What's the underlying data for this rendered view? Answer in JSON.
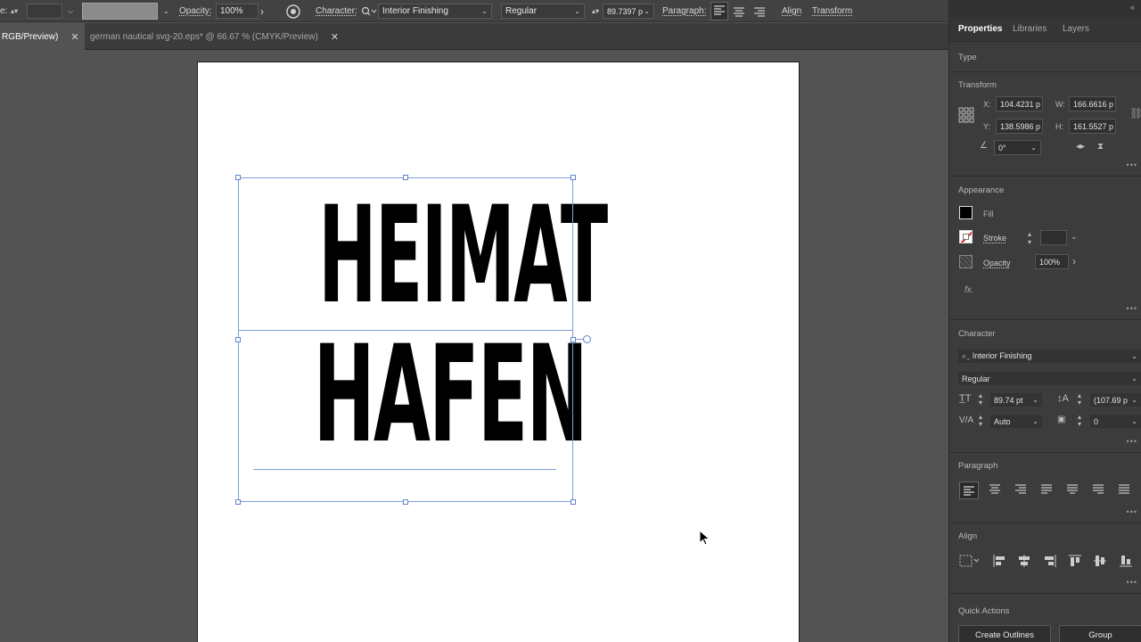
{
  "control_bar": {
    "opacity_label": "Opacity:",
    "opacity_value": "100%",
    "character_label": "Character:",
    "font_family": "Interior Finishing",
    "font_style": "Regular",
    "font_size": "89.7397 p",
    "paragraph_label": "Paragraph:",
    "align_label": "Align",
    "transform_label": "Transform"
  },
  "document_tabs": [
    {
      "label": "RGB/Preview)",
      "active": true
    },
    {
      "label": "german nautical svg-20.eps* @ 66.67 % (CMYK/Preview)",
      "active": false
    }
  ],
  "artwork": {
    "line1": "HEIMAT",
    "line2": "HAFEN"
  },
  "panel": {
    "tabs": [
      "Properties",
      "Libraries",
      "Layers"
    ],
    "type_label": "Type",
    "transform": {
      "title": "Transform",
      "x_label": "X:",
      "x_value": "104.4231 p",
      "y_label": "Y:",
      "y_value": "138.5986 p",
      "w_label": "W:",
      "w_value": "166.6616 p",
      "h_label": "H:",
      "h_value": "161.5527 p",
      "angle_value": "0°"
    },
    "appearance": {
      "title": "Appearance",
      "fill_label": "Fill",
      "stroke_label": "Stroke",
      "opacity_label": "Opacity",
      "opacity_value": "100%",
      "fx_label": "fx."
    },
    "character": {
      "title": "Character",
      "font_family": "Interior Finishing",
      "font_style": "Regular",
      "font_size": "89.74 pt",
      "leading": "(107.69 p",
      "kerning": "Auto",
      "tracking": "0"
    },
    "paragraph_title": "Paragraph",
    "align_title": "Align",
    "quick_actions": {
      "title": "Quick Actions",
      "create_outlines": "Create Outlines",
      "group": "Group"
    }
  },
  "colors": {
    "ui_dark": "#424242",
    "canvas": "#535353",
    "selection": "#7d9fd6",
    "artwork_text": "#000000"
  }
}
